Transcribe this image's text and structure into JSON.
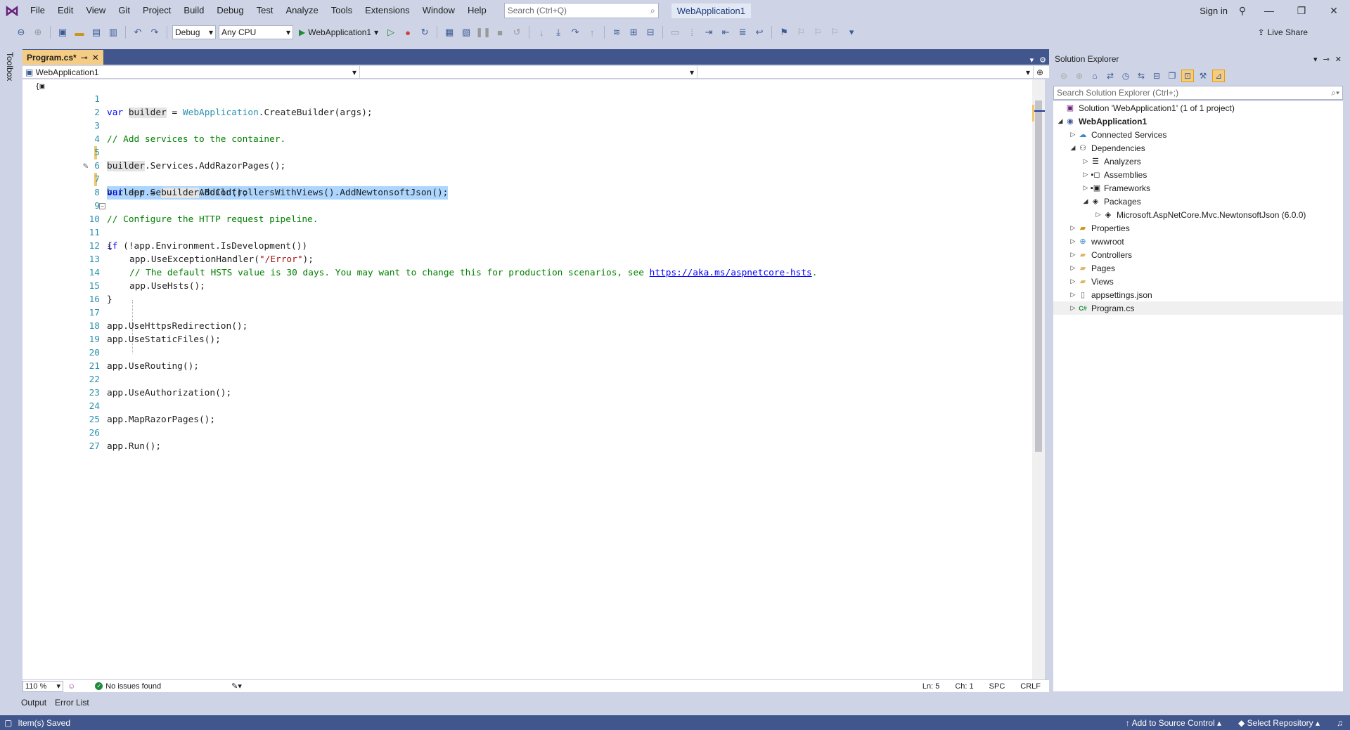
{
  "menu": {
    "items": [
      "File",
      "Edit",
      "View",
      "Git",
      "Project",
      "Build",
      "Debug",
      "Test",
      "Analyze",
      "Tools",
      "Extensions",
      "Window",
      "Help"
    ],
    "search_placeholder": "Search (Ctrl+Q)",
    "solution_name": "WebApplication1",
    "sign_in": "Sign in"
  },
  "toolbar": {
    "configuration": "Debug",
    "platform": "Any CPU",
    "run_target": "WebApplication1",
    "live_share": "Live Share"
  },
  "toolbox": {
    "label": "Toolbox"
  },
  "editor": {
    "tab_label": "Program.cs*",
    "nav_project": "WebApplication1",
    "zoom": "110 %",
    "issues": "No issues found",
    "ln": "Ln: 5",
    "ch": "Ch: 1",
    "spc": "SPC",
    "crlf": "CRLF",
    "line_numbers": [
      "1",
      "2",
      "3",
      "4",
      "5",
      "6",
      "7",
      "8",
      "9",
      "10",
      "11",
      "12",
      "13",
      "14",
      "15",
      "16",
      "17",
      "18",
      "19",
      "20",
      "21",
      "22",
      "23",
      "24",
      "25",
      "26",
      "27"
    ],
    "code": {
      "l1": {
        "kw": "var",
        "id": "builder",
        "eq": " = ",
        "type": "WebApplication",
        "call": ".CreateBuilder(",
        "arg": "args",
        "end": ");"
      },
      "l3": "// Add services to the container.",
      "l4": {
        "id": "builder",
        "rest": ".Services.AddRazorPages();"
      },
      "l5": "builder.Services.AddControllersWithViews().AddNewtonsoftJson();",
      "l7": {
        "kw": "var",
        "mid": " app = ",
        "id": "builder",
        "rest": ".Build();"
      },
      "l9": "// Configure the HTTP request pipeline.",
      "l10": {
        "kw": "if",
        "rest": " (!app.Environment.IsDevelopment())"
      },
      "l11": "{",
      "l12": {
        "pre": "app.UseExceptionHandler(",
        "str": "\"/Error\"",
        "post": ");"
      },
      "l13": {
        "comment": "// The default HSTS value is 30 days. You may want to change this for production scenarios, see ",
        "link": "https://aka.ms/aspnetcore-hsts",
        "dot": "."
      },
      "l14": "app.UseHsts();",
      "l15": "}",
      "l17": "app.UseHttpsRedirection();",
      "l18": "app.UseStaticFiles();",
      "l20": "app.UseRouting();",
      "l22": "app.UseAuthorization();",
      "l24": "app.MapRazorPages();",
      "l26": "app.Run();"
    }
  },
  "bottom_tabs": [
    "Output",
    "Error List"
  ],
  "statusbar": {
    "message": "Item(s) Saved",
    "add_source": "Add to Source Control",
    "select_repo": "Select Repository"
  },
  "solution_explorer": {
    "title": "Solution Explorer",
    "search_placeholder": "Search Solution Explorer (Ctrl+;)",
    "tree": [
      {
        "label": "Solution 'WebApplication1' (1 of 1 project)",
        "icon": "solution-icon"
      },
      {
        "label": "WebApplication1",
        "icon": "project-icon"
      },
      {
        "label": "Connected Services",
        "icon": "connected-services-icon"
      },
      {
        "label": "Dependencies",
        "icon": "dependencies-icon"
      },
      {
        "label": "Analyzers",
        "icon": "analyzers-icon"
      },
      {
        "label": "Assemblies",
        "icon": "assemblies-icon"
      },
      {
        "label": "Frameworks",
        "icon": "frameworks-icon"
      },
      {
        "label": "Packages",
        "icon": "packages-icon"
      },
      {
        "label": "Microsoft.AspNetCore.Mvc.NewtonsoftJson (6.0.0)",
        "icon": "package-icon"
      },
      {
        "label": "Properties",
        "icon": "properties-icon"
      },
      {
        "label": "wwwroot",
        "icon": "globe-icon"
      },
      {
        "label": "Controllers",
        "icon": "folder-icon"
      },
      {
        "label": "Pages",
        "icon": "folder-icon"
      },
      {
        "label": "Views",
        "icon": "folder-icon"
      },
      {
        "label": "appsettings.json",
        "icon": "json-file-icon"
      },
      {
        "label": "Program.cs",
        "icon": "csharp-file-icon"
      }
    ]
  }
}
